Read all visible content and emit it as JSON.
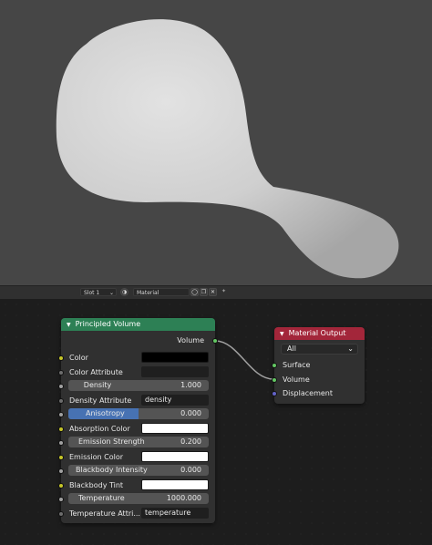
{
  "header": {
    "slot_label": "Slot 1",
    "material_name": "Material",
    "icons": [
      "material-sphere-icon",
      "shield-icon",
      "duplicate-icon",
      "close-icon",
      "pin-icon"
    ]
  },
  "principled_volume": {
    "title": "Principled Volume",
    "header_color": "#2d8055",
    "output_label": "Volume",
    "inputs": [
      {
        "label": "Color",
        "socket_color": "#c7c729",
        "widget": "swatch",
        "swatch_color": "#000000"
      },
      {
        "label": "Color Attribute",
        "socket_color": "#6d6d6d",
        "widget": "text",
        "value": ""
      },
      {
        "label": "Density",
        "socket_color": "#a1a1a1",
        "widget": "number",
        "value": "1.000"
      },
      {
        "label": "Density Attribute",
        "socket_color": "#6d6d6d",
        "widget": "text",
        "value": "density"
      },
      {
        "label": "Anisotropy",
        "socket_color": "#a1a1a1",
        "widget": "slider",
        "value": "0.000"
      },
      {
        "label": "Absorption Color",
        "socket_color": "#c7c729",
        "widget": "swatch",
        "swatch_color": "#ffffff"
      },
      {
        "label": "Emission Strength",
        "socket_color": "#a1a1a1",
        "widget": "number",
        "value": "0.200"
      },
      {
        "label": "Emission Color",
        "socket_color": "#c7c729",
        "widget": "swatch",
        "swatch_color": "#ffffff"
      },
      {
        "label": "Blackbody Intensity",
        "socket_color": "#a1a1a1",
        "widget": "number",
        "value": "0.000"
      },
      {
        "label": "Blackbody Tint",
        "socket_color": "#c7c729",
        "widget": "swatch",
        "swatch_color": "#ffffff"
      },
      {
        "label": "Temperature",
        "socket_color": "#a1a1a1",
        "widget": "number",
        "value": "1000.000"
      },
      {
        "label": "Temperature Attri...",
        "socket_color": "#6d6d6d",
        "widget": "text",
        "value": "temperature"
      }
    ]
  },
  "material_output": {
    "title": "Material Output",
    "header_color": "#a3263a",
    "target": "All",
    "inputs": [
      {
        "label": "Surface",
        "socket_color": "#63c763"
      },
      {
        "label": "Volume",
        "socket_color": "#63c763"
      },
      {
        "label": "Displacement",
        "socket_color": "#6363c7"
      }
    ]
  },
  "colors": {
    "viewport_bg": "#464646",
    "editor_bg": "#1d1d1d",
    "slider_fill": "#4772b3",
    "link": "#a0a0a0"
  }
}
